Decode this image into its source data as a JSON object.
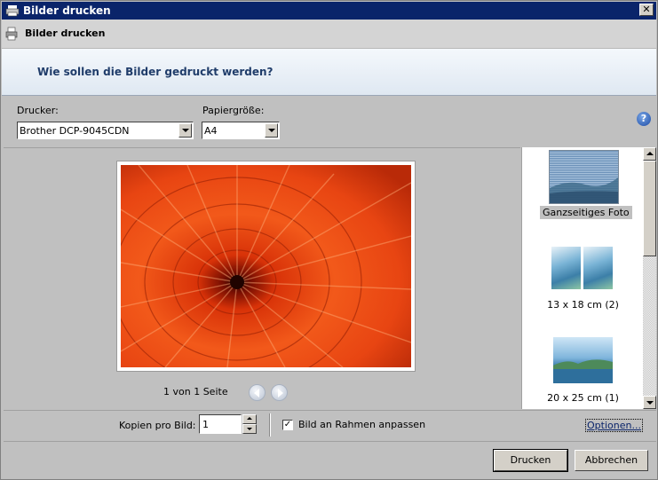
{
  "window": {
    "title": "Bilder drucken",
    "close_glyph": "✕"
  },
  "header": {
    "title": "Bilder drucken"
  },
  "banner": {
    "question": "Wie sollen die Bilder gedruckt werden?"
  },
  "printer": {
    "label": "Drucker:",
    "value": "Brother DCP-9045CDN"
  },
  "paper": {
    "label": "Papiergröße:",
    "value": "A4"
  },
  "help": {
    "glyph": "?"
  },
  "preview": {
    "pager_text": "1 von 1 Seite"
  },
  "layouts": [
    {
      "caption": "Ganzseitiges Foto",
      "selected": true
    },
    {
      "caption": "13 x 18 cm (2)",
      "selected": false
    },
    {
      "caption": "20 x 25 cm (1)",
      "selected": false
    }
  ],
  "copies": {
    "label": "Kopien pro Bild:",
    "value": "1"
  },
  "fit": {
    "label": "Bild an Rahmen anpassen",
    "checked": true,
    "check_glyph": "✓"
  },
  "options_link": "Optionen...",
  "buttons": {
    "print": "Drucken",
    "cancel": "Abbrechen"
  },
  "icons": [
    "printer-icon",
    "close-icon",
    "help-icon",
    "previous-page-icon",
    "next-page-icon",
    "checkmark-icon"
  ]
}
